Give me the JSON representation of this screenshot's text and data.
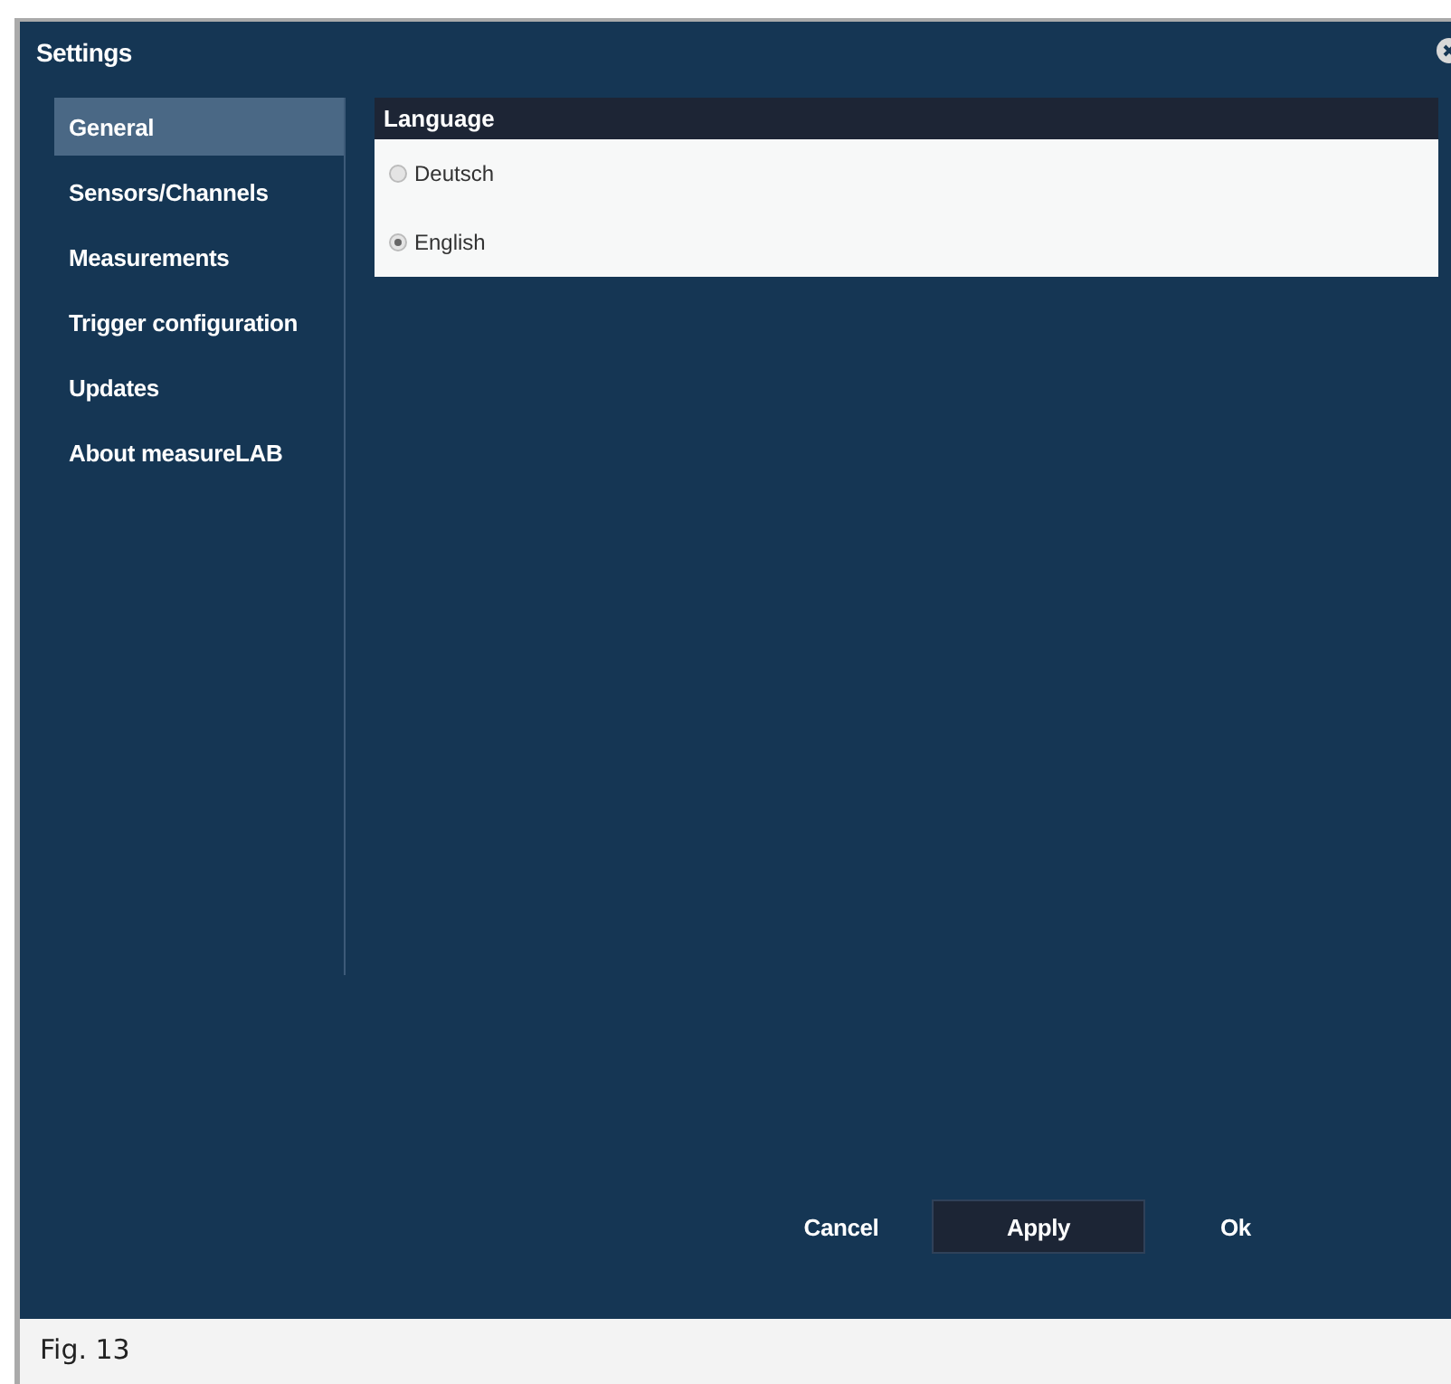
{
  "window": {
    "title": "Settings"
  },
  "sidebar": {
    "items": [
      {
        "label": "General",
        "selected": true
      },
      {
        "label": "Sensors/Channels",
        "selected": false
      },
      {
        "label": "Measurements",
        "selected": false
      },
      {
        "label": "Trigger configuration",
        "selected": false
      },
      {
        "label": "Updates",
        "selected": false
      },
      {
        "label": "About measureLAB",
        "selected": false
      }
    ]
  },
  "language": {
    "title": "Language",
    "options": [
      {
        "label": "Deutsch",
        "selected": false
      },
      {
        "label": "English",
        "selected": true
      }
    ]
  },
  "buttons": [
    {
      "label": "Cancel",
      "kind": "plain"
    },
    {
      "label": "Apply",
      "kind": "boxed"
    },
    {
      "label": "Ok",
      "kind": "plain"
    }
  ],
  "caption": "Fig. 13"
}
